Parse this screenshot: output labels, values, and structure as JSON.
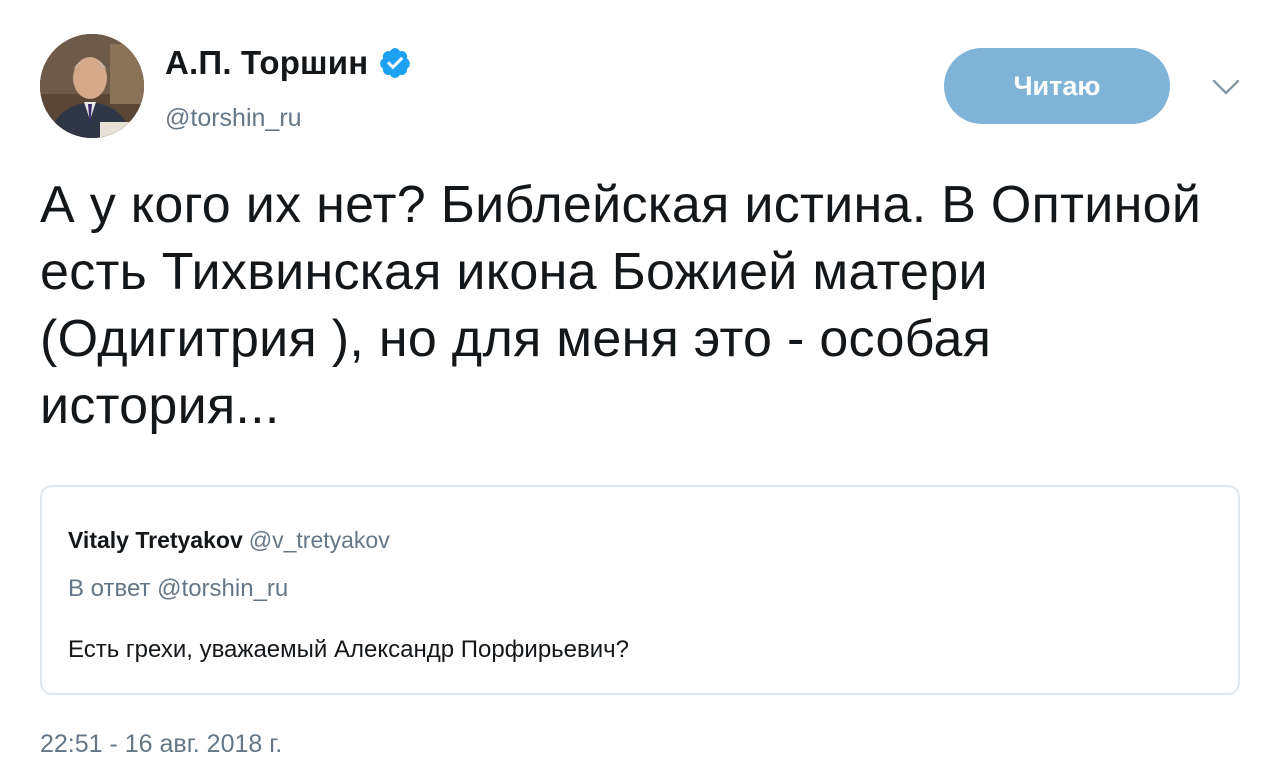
{
  "tweet": {
    "author": {
      "name": "А.П. Торшин",
      "handle": "@torshin_ru",
      "verified": true,
      "avatar_icon": "avatar-photo-icon"
    },
    "follow_button_label": "Читаю",
    "more_icon": "chevron-down-icon",
    "text": "А у кого их нет? Библейская истина. В Оптиной есть Тихвинская икона Божией матери (Одигитрия ), но для меня это - особая история...",
    "quoted": {
      "name": "Vitaly Tretyakov",
      "handle": "@v_tretyakov",
      "reply_to": "В ответ @torshin_ru",
      "text": "Есть грехи, уважаемый Александр Порфирьевич?"
    },
    "timestamp": "22:51 - 16 авг. 2018 г."
  },
  "colors": {
    "text_primary": "#14171a",
    "text_secondary": "#657786",
    "follow_button_bg": "#7fb4d8",
    "verified_badge": "#1da1f2",
    "card_border": "#e1e8ed"
  }
}
